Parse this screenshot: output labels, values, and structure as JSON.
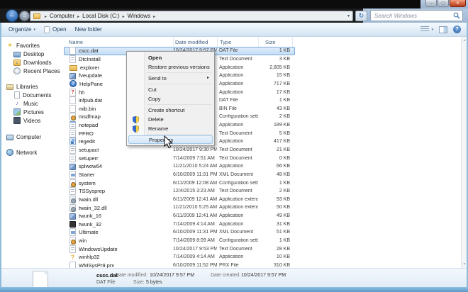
{
  "glyphs": {
    "back": "←",
    "forward": "→",
    "crumb_sep": "▸",
    "dropdown": "▾",
    "refresh": "↻",
    "search": "🔍",
    "caret": "▾",
    "help": "?",
    "min": "–",
    "max": "▢",
    "close": "✕",
    "scroll_up": "▲",
    "scroll_down": "▼",
    "submenu": "▸"
  },
  "colors": {
    "selection_fill": "#c4ddf4",
    "selection_border": "#7da9d9",
    "menu_highlight": "#d4e6f7",
    "close_button": "#c2452c",
    "aero_blue": "#9cb3cf",
    "bottom_strip": "#5f97c6"
  },
  "address_bar": {
    "breadcrumb": [
      "Computer",
      "Local Disk (C:)",
      "Windows"
    ],
    "search_placeholder": "Search Windows"
  },
  "toolbar": {
    "organize": "Organize",
    "open": "Open",
    "new_folder": "New folder"
  },
  "sidebar": {
    "items": [
      {
        "label": "Favorites",
        "icon": "star-icon",
        "cls": "si-star",
        "glyph": "★",
        "level": 0,
        "gap": 0
      },
      {
        "label": "Desktop",
        "icon": "desktop-icon",
        "cls": "si-desktop",
        "level": 1,
        "gap": 0
      },
      {
        "label": "Downloads",
        "icon": "downloads-icon",
        "cls": "si-downloads",
        "glyph": "↓",
        "level": 1,
        "gap": 0
      },
      {
        "label": "Recent Places",
        "icon": "recent-places-icon",
        "cls": "si-recent",
        "level": 1,
        "gap": 0
      },
      {
        "label": "Libraries",
        "icon": "libraries-icon",
        "cls": "si-lib",
        "level": 0,
        "gap": 10
      },
      {
        "label": "Documents",
        "icon": "documents-icon",
        "cls": "si-docs",
        "level": 1,
        "gap": 0
      },
      {
        "label": "Music",
        "icon": "music-icon",
        "cls": "si-music",
        "glyph": "♪",
        "level": 1,
        "gap": 0
      },
      {
        "label": "Pictures",
        "icon": "pictures-icon",
        "cls": "si-pics",
        "level": 1,
        "gap": 0
      },
      {
        "label": "Videos",
        "icon": "videos-icon",
        "cls": "si-videos",
        "level": 1,
        "gap": 0
      },
      {
        "label": "Computer",
        "icon": "computer-icon",
        "cls": "si-computer",
        "level": 0,
        "gap": 11
      },
      {
        "label": "Network",
        "icon": "network-icon",
        "cls": "si-network",
        "level": 0,
        "gap": 10
      }
    ]
  },
  "file_list": {
    "columns": [
      "Name",
      "Date modified",
      "Type",
      "Size"
    ],
    "rows": [
      {
        "name": "cscc.dat",
        "date": "10/24/2017 9:57 PM",
        "type": "DAT File",
        "size": "1 KB",
        "icon": "dat-file-icon",
        "cls": "",
        "selected": true
      },
      {
        "name": "DtcInstall",
        "date": "",
        "type": "Text Document",
        "size": "3 KB",
        "icon": "text-document-icon",
        "cls": "fi-text"
      },
      {
        "name": "explorer",
        "date": "",
        "type": "Application",
        "size": "2,805 KB",
        "icon": "explorer-application-icon",
        "cls": "fi-folder"
      },
      {
        "name": "fveupdate",
        "date": "",
        "type": "Application",
        "size": "15 KB",
        "icon": "application-icon",
        "cls": "fi-app"
      },
      {
        "name": "HelpPane",
        "date": "",
        "type": "Application",
        "size": "717 KB",
        "icon": "help-application-icon",
        "cls": "fi-help",
        "glyph": "?"
      },
      {
        "name": "hh",
        "date": "",
        "type": "Application",
        "size": "17 KB",
        "icon": "html-help-icon",
        "cls": "fi-qred",
        "glyph": "?"
      },
      {
        "name": "infpub.dat",
        "date": "",
        "type": "DAT File",
        "size": "1 KB",
        "icon": "dat-file-icon",
        "cls": ""
      },
      {
        "name": "mib.bin",
        "date": "",
        "type": "BIN File",
        "size": "43 KB",
        "icon": "bin-file-icon",
        "cls": ""
      },
      {
        "name": "msdfmap",
        "date": "",
        "type": "Configuration sett...",
        "size": "2 KB",
        "icon": "configuration-file-icon",
        "cls": "fi-config"
      },
      {
        "name": "notepad",
        "date": "",
        "type": "Application",
        "size": "189 KB",
        "icon": "notepad-icon",
        "cls": "fi-notepad"
      },
      {
        "name": "PFRO",
        "date": "",
        "type": "Text Document",
        "size": "5 KB",
        "icon": "text-document-icon",
        "cls": "fi-text"
      },
      {
        "name": "regedit",
        "date": "",
        "type": "Application",
        "size": "417 KB",
        "icon": "registry-editor-icon",
        "cls": "fi-reg"
      },
      {
        "name": "setupact",
        "date": "10/24/2017 9:30 PM",
        "type": "Text Document",
        "size": "21 KB",
        "icon": "text-document-icon",
        "cls": "fi-text"
      },
      {
        "name": "setuperr",
        "date": "7/14/2009 7:51 AM",
        "type": "Text Document",
        "size": "0 KB",
        "icon": "text-document-icon",
        "cls": "fi-text"
      },
      {
        "name": "splwow64",
        "date": "11/21/2010 5:24 AM",
        "type": "Application",
        "size": "66 KB",
        "icon": "application-icon",
        "cls": "fi-app"
      },
      {
        "name": "Starter",
        "date": "6/10/2009 11:31 PM",
        "type": "XML Document",
        "size": "48 KB",
        "icon": "xml-document-icon",
        "cls": "fi-xml"
      },
      {
        "name": "system",
        "date": "6/11/2009 12:08 AM",
        "type": "Configuration sett...",
        "size": "1 KB",
        "icon": "configuration-file-icon",
        "cls": "fi-config"
      },
      {
        "name": "TSSysprep",
        "date": "12/4/2015 3:23 AM",
        "type": "Text Document",
        "size": "2 KB",
        "icon": "text-document-icon",
        "cls": "fi-text"
      },
      {
        "name": "twain.dll",
        "date": "6/11/2009 12:41 AM",
        "type": "Application extens...",
        "size": "93 KB",
        "icon": "dll-file-icon",
        "cls": "fi-dll"
      },
      {
        "name": "twain_32.dll",
        "date": "11/21/2010 5:25 AM",
        "type": "Application extens...",
        "size": "50 KB",
        "icon": "dll-file-icon",
        "cls": "fi-dll"
      },
      {
        "name": "twunk_16",
        "date": "6/11/2009 12:41 AM",
        "type": "Application",
        "size": "49 KB",
        "icon": "application-icon",
        "cls": "fi-app"
      },
      {
        "name": "twunk_32",
        "date": "7/14/2009 4:14 AM",
        "type": "Application",
        "size": "31 KB",
        "icon": "application-icon",
        "cls": "fi-app-dark"
      },
      {
        "name": "Ultimate",
        "date": "6/10/2009 11:31 PM",
        "type": "XML Document",
        "size": "51 KB",
        "icon": "xml-document-icon",
        "cls": "fi-xml"
      },
      {
        "name": "win",
        "date": "7/14/2009 8:09 AM",
        "type": "Configuration sett...",
        "size": "1 KB",
        "icon": "configuration-file-icon",
        "cls": "fi-config"
      },
      {
        "name": "WindowsUpdate",
        "date": "10/24/2017 9:53 PM",
        "type": "Text Document",
        "size": "28 KB",
        "icon": "text-document-icon",
        "cls": "fi-text"
      },
      {
        "name": "winhlp32",
        "date": "7/14/2009 4:14 AM",
        "type": "Application",
        "size": "10 KB",
        "icon": "winhelp-icon",
        "cls": "fi-qyellow",
        "glyph": "?"
      },
      {
        "name": "WMSysPr9.prx",
        "date": "6/10/2009 11:52 PM",
        "type": "PRX File",
        "size": "310 KB",
        "icon": "prx-file-icon",
        "cls": ""
      }
    ]
  },
  "context_menu": {
    "items": [
      {
        "label": "Open",
        "bold": true
      },
      {
        "label": "Restore previous versions"
      },
      {
        "separator": true
      },
      {
        "label": "Send to",
        "submenu": true
      },
      {
        "separator": true
      },
      {
        "label": "Cut"
      },
      {
        "label": "Copy"
      },
      {
        "separator": true
      },
      {
        "label": "Create shortcut"
      },
      {
        "label": "Delete",
        "shield": true
      },
      {
        "label": "Rename",
        "shield": true
      },
      {
        "separator": true
      },
      {
        "label": "Properties",
        "highlighted": true
      }
    ]
  },
  "details_pane": {
    "file_name": "cscc.dat",
    "date_modified_label": "Date modified:",
    "date_modified": "10/24/2017 9:57 PM",
    "date_created_label": "Date created:",
    "date_created": "10/24/2017 9:57 PM",
    "file_type": "DAT File",
    "size_label": "Size:",
    "size": "5 bytes"
  }
}
